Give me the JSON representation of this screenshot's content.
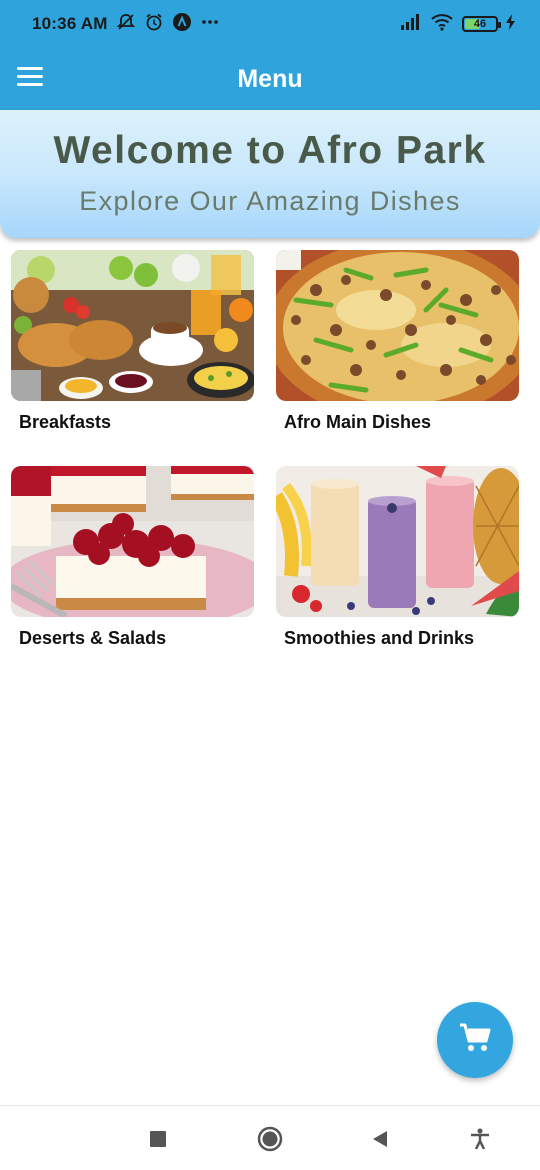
{
  "status_bar": {
    "time": "10:36 AM",
    "battery": "46",
    "icons": [
      "notifications-off-icon",
      "alarm-icon",
      "app-a-icon",
      "more-icon",
      "signal-icon",
      "wifi-icon",
      "battery-icon",
      "charging-icon"
    ]
  },
  "app_bar": {
    "title": "Menu",
    "menu_icon": "hamburger-menu-icon"
  },
  "hero": {
    "title": "Welcome to Afro Park",
    "subtitle": "Explore Our Amazing Dishes"
  },
  "categories": [
    {
      "label": "Breakfasts",
      "image": "breakfast-spread"
    },
    {
      "label": "Afro Main Dishes",
      "image": "pizza"
    },
    {
      "label": "Deserts & Salads",
      "image": "cherry-cheesecake"
    },
    {
      "label": "Smoothies and Drinks",
      "image": "smoothies"
    }
  ],
  "fab": {
    "icon": "shopping-cart-icon"
  },
  "nav_bar": {
    "icons": [
      "recent-apps-icon",
      "home-icon",
      "back-icon",
      "accessibility-icon"
    ]
  },
  "colors": {
    "primary": "#2ea3dc",
    "fab": "#33a6df",
    "hero_top": "#ddf1fb",
    "hero_bottom": "#a6d6fb",
    "hero_title": "#4a5a4a"
  }
}
